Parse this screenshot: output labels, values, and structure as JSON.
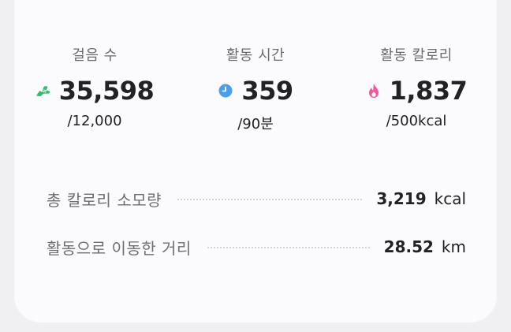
{
  "colors": {
    "steps_icon": "#2ebd6b",
    "time_icon": "#4a9ef0",
    "calorie_icon": "#ef5a9c"
  },
  "stats": {
    "steps": {
      "label": "걸음 수",
      "value": "35,598",
      "goal": "/12,000",
      "icon": "running-shoe-icon"
    },
    "time": {
      "label": "활동 시간",
      "value": "359",
      "goal": "/90분",
      "icon": "clock-icon"
    },
    "calories": {
      "label": "활동 칼로리",
      "value": "1,837",
      "goal": "/500kcal",
      "icon": "flame-icon"
    }
  },
  "summary": {
    "calories": {
      "label": "총 칼로리 소모량",
      "value": "3,219",
      "unit": "kcal"
    },
    "distance": {
      "label": "활동으로 이동한 거리",
      "value": "28.52",
      "unit": "km"
    }
  }
}
